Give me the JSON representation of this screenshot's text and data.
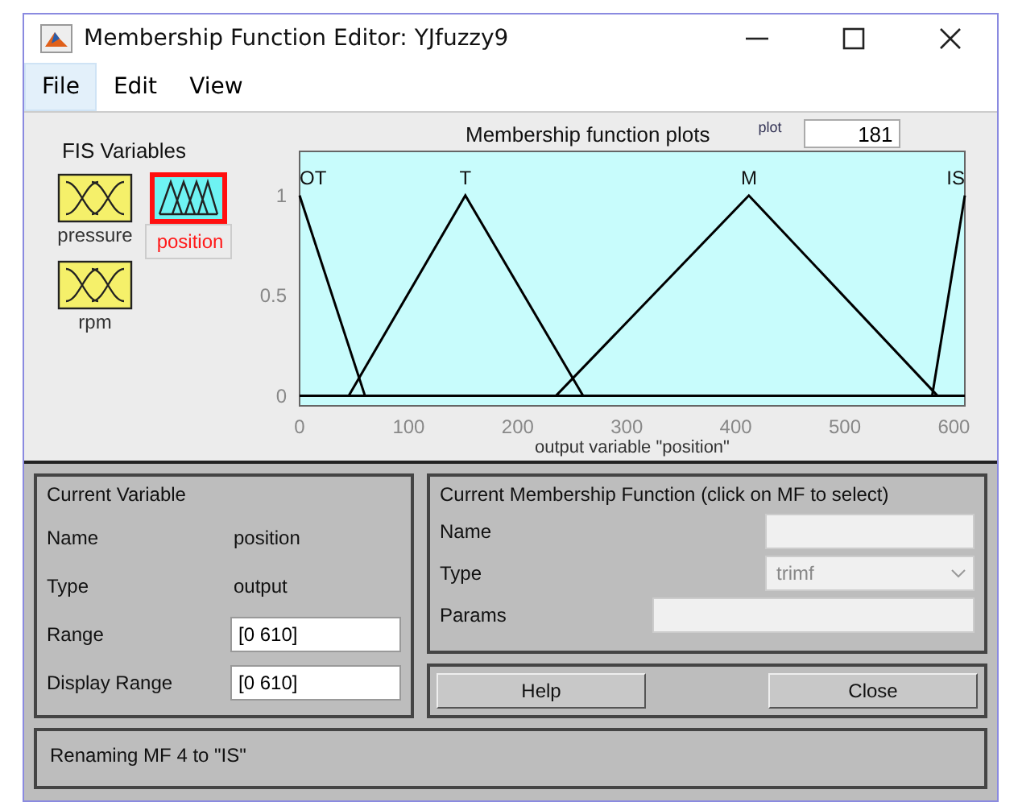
{
  "window": {
    "title": "Membership Function Editor: YJfuzzy9"
  },
  "menu": [
    {
      "label": "File",
      "selected": true
    },
    {
      "label": "Edit",
      "selected": false
    },
    {
      "label": "View",
      "selected": false
    }
  ],
  "fis_variables": {
    "title": "FIS Variables",
    "items": [
      {
        "name": "pressure",
        "kind": "input",
        "selected": false
      },
      {
        "name": "position",
        "kind": "output",
        "selected": true
      },
      {
        "name": "rpm",
        "kind": "input",
        "selected": false
      }
    ]
  },
  "plot": {
    "title": "Membership function plots",
    "points_label": "plot",
    "points_value": "181",
    "chart_data": {
      "type": "line",
      "xlabel": "output variable \"position\"",
      "xlim": [
        0,
        610
      ],
      "ylim": [
        -0.05,
        1.22
      ],
      "xticks": [
        0,
        100,
        200,
        300,
        400,
        500,
        600
      ],
      "yticks": [
        0,
        0.5,
        1
      ],
      "series": [
        {
          "name": "OT",
          "color": "#000000",
          "x": [
            0,
            60
          ],
          "values": [
            1,
            0
          ]
        },
        {
          "name": "T",
          "color": "#000000",
          "x": [
            45,
            152,
            260
          ],
          "values": [
            0,
            1,
            0
          ]
        },
        {
          "name": "M",
          "color": "#000000",
          "x": [
            235,
            412,
            585
          ],
          "values": [
            0,
            1,
            0
          ]
        },
        {
          "name": "IS",
          "color": "#000000",
          "x": [
            580,
            610
          ],
          "values": [
            0,
            1
          ]
        }
      ]
    }
  },
  "current_variable": {
    "title": "Current Variable",
    "rows": [
      {
        "kind": "text",
        "label": "Name",
        "value": "position"
      },
      {
        "kind": "text",
        "label": "Type",
        "value": "output"
      },
      {
        "kind": "field",
        "label": "Range",
        "value": "[0 610]"
      },
      {
        "kind": "field",
        "label": "Display Range",
        "value": "[0 610]"
      }
    ]
  },
  "current_mf": {
    "title": "Current Membership Function (click on MF to select)",
    "fields": [
      {
        "kind": "field",
        "label": "Name",
        "disabled": true
      },
      {
        "kind": "select",
        "label": "Type",
        "value": "trimf",
        "disabled": true
      },
      {
        "kind": "wide_field",
        "label": "Params",
        "disabled": true
      }
    ]
  },
  "buttons": [
    "Help",
    "Close"
  ],
  "status": "Renaming MF 4 to \"IS\""
}
